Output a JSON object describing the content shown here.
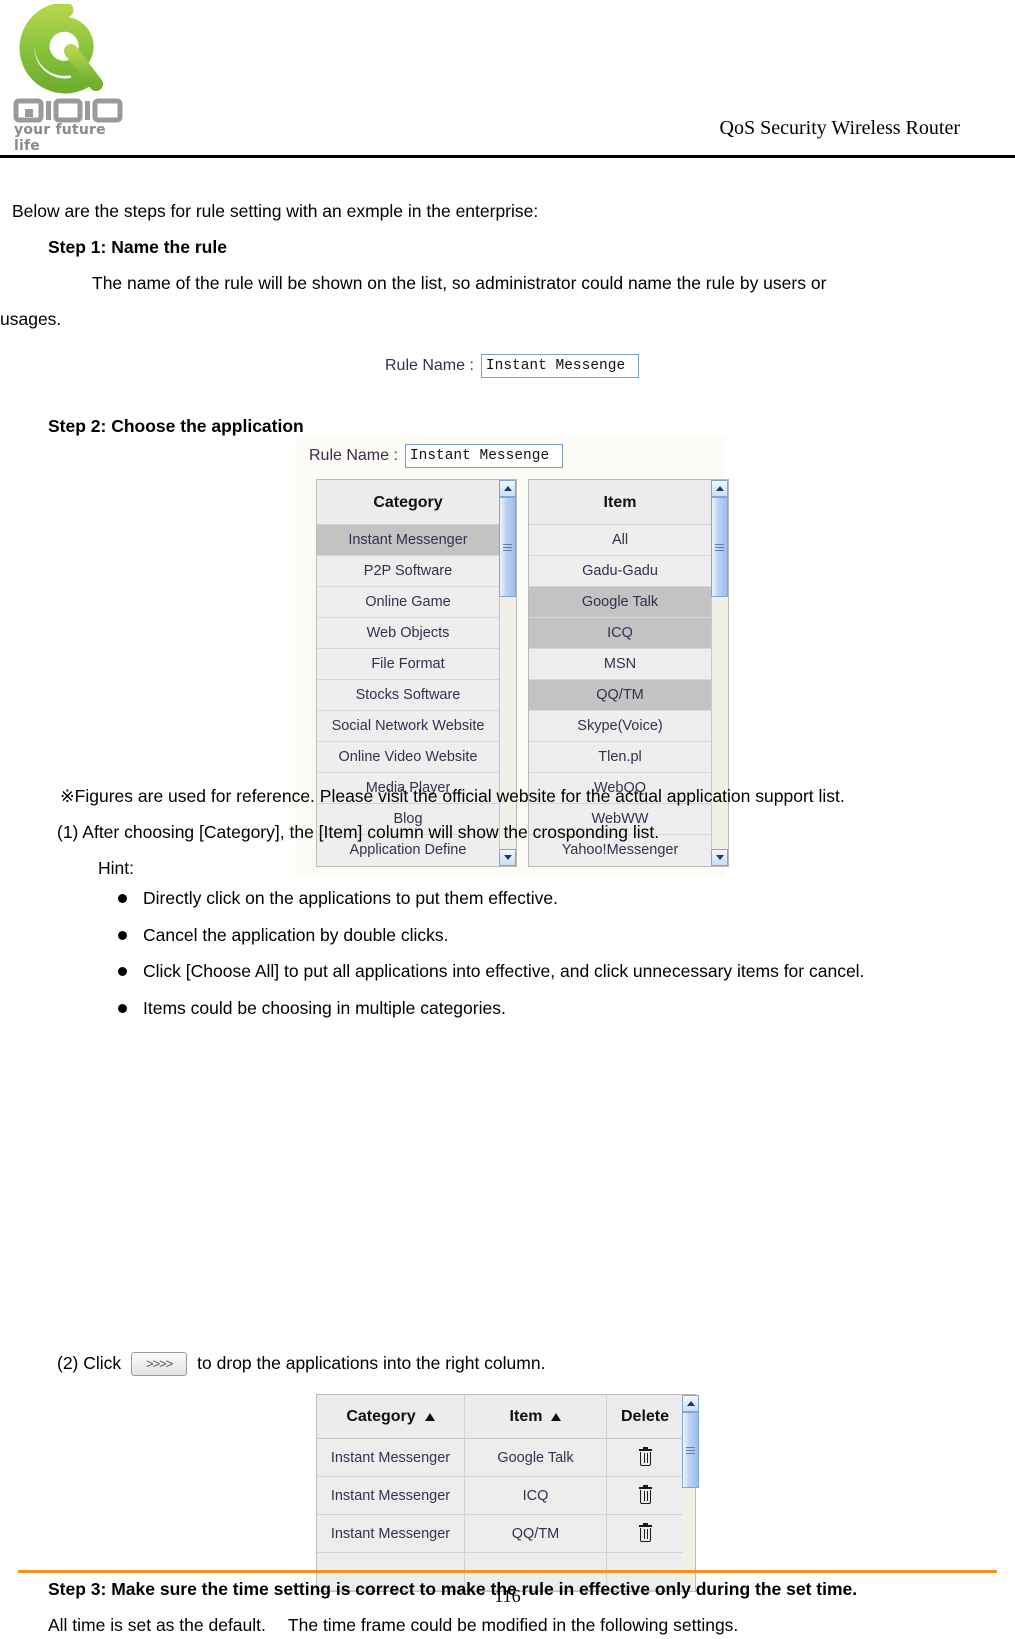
{
  "header": {
    "title": "QoS Security Wireless Router",
    "logo": {
      "mark": "qno-logo",
      "wordmark": "QNO",
      "tagline": "your future life"
    }
  },
  "body": {
    "intro": "Below are the steps for rule setting with an exmple in the enterprise:",
    "step1_heading": "Step 1: Name the rule",
    "step1_desc_line1": "The name of the rule will be shown on the list, so administrator could name the rule by users or",
    "step1_desc_line2": "usages.",
    "step2_heading": "Step 2: Choose the application",
    "note_figures": "※Figures are used for reference. Please visit the official website for the actual application support list.",
    "item_1": "(1) After choosing [Category], the [Item] column will show the crosponding list.",
    "hint_label": "Hint:",
    "hints": [
      "Directly click on the applications to put them effective.",
      "Cancel the application by double clicks.",
      "Click [Choose All] to put all applications into effective, and click unnecessary items for cancel.",
      "Items could be choosing in multiple categories."
    ],
    "item_2_prefix": "(2) Click",
    "item_2_button": ">>>>",
    "item_2_suffix": "to drop the applications into the right column.",
    "step3_heading": "Step 3: Make sure the time setting is correct to make the rule in effective only during the set time.",
    "closing": "All time is set as the default.  The time frame could be modified in the following settings."
  },
  "figure_rule_name": {
    "label": "Rule Name :",
    "value": "Instant Messenge",
    "placeholder": ""
  },
  "figure_picker": {
    "rule_name_label": "Rule Name :",
    "rule_name_value": "Instant Messenge",
    "category": {
      "header": "Category",
      "rows": [
        {
          "label": "Instant Messenger",
          "selected": true
        },
        {
          "label": "P2P Software",
          "selected": false
        },
        {
          "label": "Online Game",
          "selected": false
        },
        {
          "label": "Web Objects",
          "selected": false
        },
        {
          "label": "File Format",
          "selected": false
        },
        {
          "label": "Stocks Software",
          "selected": false
        },
        {
          "label": "Social Network Website",
          "selected": false
        },
        {
          "label": "Online Video Website",
          "selected": false
        },
        {
          "label": "Media Player",
          "selected": false
        },
        {
          "label": "Blog",
          "selected": false
        },
        {
          "label": "Application Define",
          "selected": false
        }
      ]
    },
    "item": {
      "header": "Item",
      "rows": [
        {
          "label": "All",
          "selected": false
        },
        {
          "label": "Gadu-Gadu",
          "selected": false
        },
        {
          "label": "Google Talk",
          "selected": true
        },
        {
          "label": "ICQ",
          "selected": true
        },
        {
          "label": "MSN",
          "selected": false
        },
        {
          "label": "QQ/TM",
          "selected": true
        },
        {
          "label": "Skype(Voice)",
          "selected": false
        },
        {
          "label": "Tlen.pl",
          "selected": false
        },
        {
          "label": "WebQQ",
          "selected": false
        },
        {
          "label": "WebWW",
          "selected": false
        },
        {
          "label": "Yahoo!Messenger",
          "selected": false
        }
      ]
    }
  },
  "figure_chosen": {
    "columns": [
      "Category",
      "Item",
      "Delete"
    ],
    "rows": [
      {
        "category": "Instant Messenger",
        "item": "Google Talk",
        "delete": "delete-icon"
      },
      {
        "category": "Instant Messenger",
        "item": "ICQ",
        "delete": "delete-icon"
      },
      {
        "category": "Instant Messenger",
        "item": "QQ/TM",
        "delete": "delete-icon"
      },
      {
        "category": "",
        "item": "",
        "delete": ""
      }
    ]
  },
  "footer": {
    "page_number": "116",
    "rule_color": "#f7921e"
  }
}
